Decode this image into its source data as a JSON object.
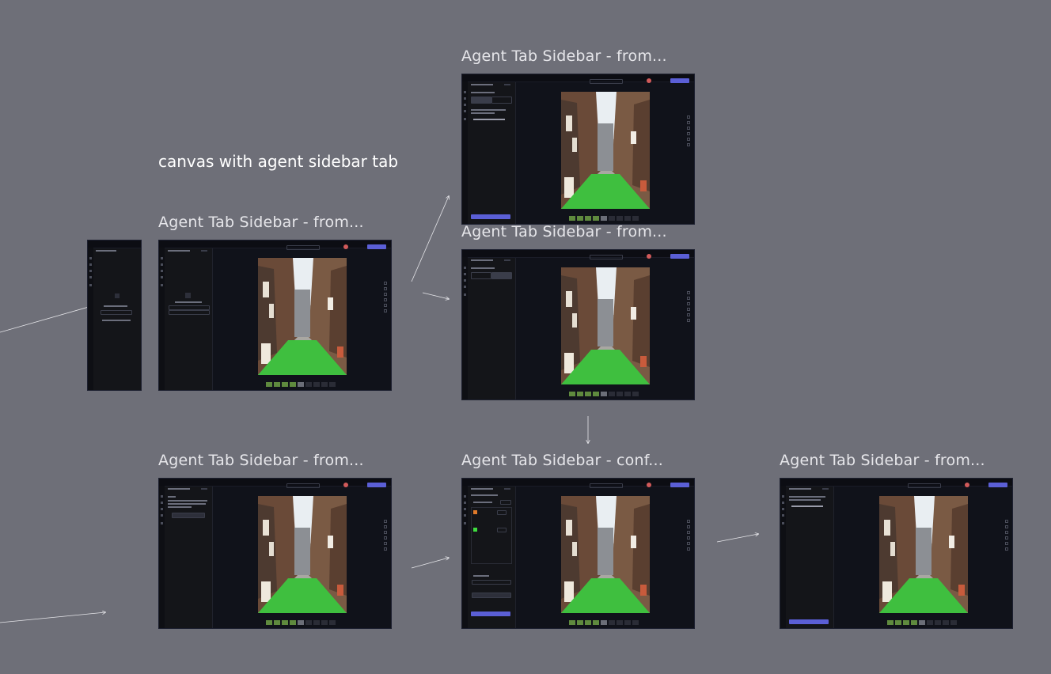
{
  "board": {
    "note": "canvas with agent sidebar tab"
  },
  "frames": [
    {
      "id": "f1",
      "title": "Agent Tab Sidebar - from..."
    },
    {
      "id": "f2",
      "title": "Agent Tab Sidebar - from..."
    },
    {
      "id": "f3",
      "title": "Agent Tab Sidebar - from..."
    },
    {
      "id": "f4",
      "title": "Agent Tab Sidebar - from..."
    },
    {
      "id": "f5",
      "title": "Agent Tab Sidebar - conf..."
    },
    {
      "id": "f6",
      "title": "Agent Tab Sidebar - from..."
    }
  ],
  "colors": {
    "board": "#6e6f78",
    "frame": "#10121a",
    "accent": "#5b5fd6",
    "grass": "#3fbf3f"
  }
}
